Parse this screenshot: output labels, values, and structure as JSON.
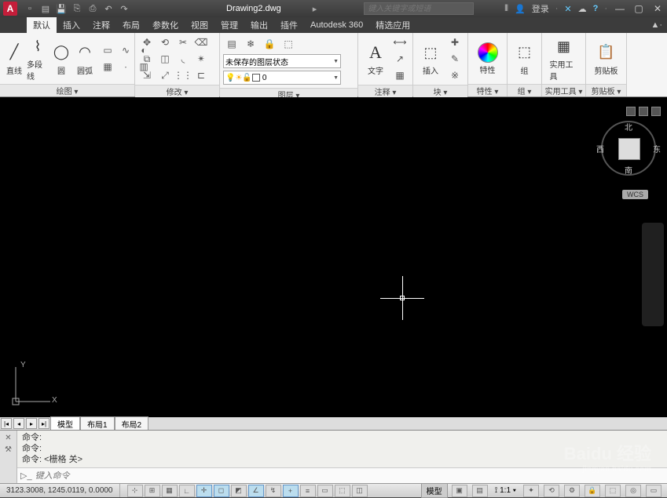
{
  "title": "Drawing2.dwg",
  "search_placeholder": "键入关键字或短语",
  "login_label": "登录",
  "menu": {
    "items": [
      "默认",
      "插入",
      "注释",
      "布局",
      "参数化",
      "视图",
      "管理",
      "输出",
      "插件",
      "Autodesk 360",
      "精选应用"
    ],
    "active": 0
  },
  "ribbon": {
    "draw": {
      "title": "绘图 ▾",
      "line": "直线",
      "polyline": "多段线",
      "circle": "圆",
      "arc": "圆弧"
    },
    "modify": {
      "title": "修改 ▾"
    },
    "layers": {
      "title": "图层 ▾",
      "unsaved_state": "未保存的图层状态",
      "current": "0"
    },
    "annotation": {
      "title": "注释 ▾",
      "text": "文字"
    },
    "block": {
      "title": "块 ▾",
      "insert": "插入"
    },
    "properties": {
      "title": "特性 ▾",
      "label": "特性"
    },
    "groups": {
      "title": "组 ▾",
      "label": "组"
    },
    "utilities": {
      "title": "实用工具 ▾",
      "label": "实用工具"
    },
    "clipboard": {
      "title": "剪贴板 ▾",
      "label": "剪贴板"
    }
  },
  "viewcube": {
    "n": "北",
    "s": "南",
    "e": "东",
    "w": "西",
    "wcs": "WCS"
  },
  "ucs": {
    "x": "X",
    "y": "Y"
  },
  "tabs": {
    "model": "模型",
    "layout1": "布局1",
    "layout2": "布局2"
  },
  "command": {
    "history": [
      "命令:",
      "命令:",
      "命令: <栅格 关>"
    ],
    "placeholder": "键入命令"
  },
  "status": {
    "coords": "3123.3008, 1245.0119, 0.0000",
    "model_label": "模型",
    "scale": "1:1"
  },
  "watermark": {
    "main": "Baidu 经验",
    "sub": "jingyan.baidu.com"
  }
}
